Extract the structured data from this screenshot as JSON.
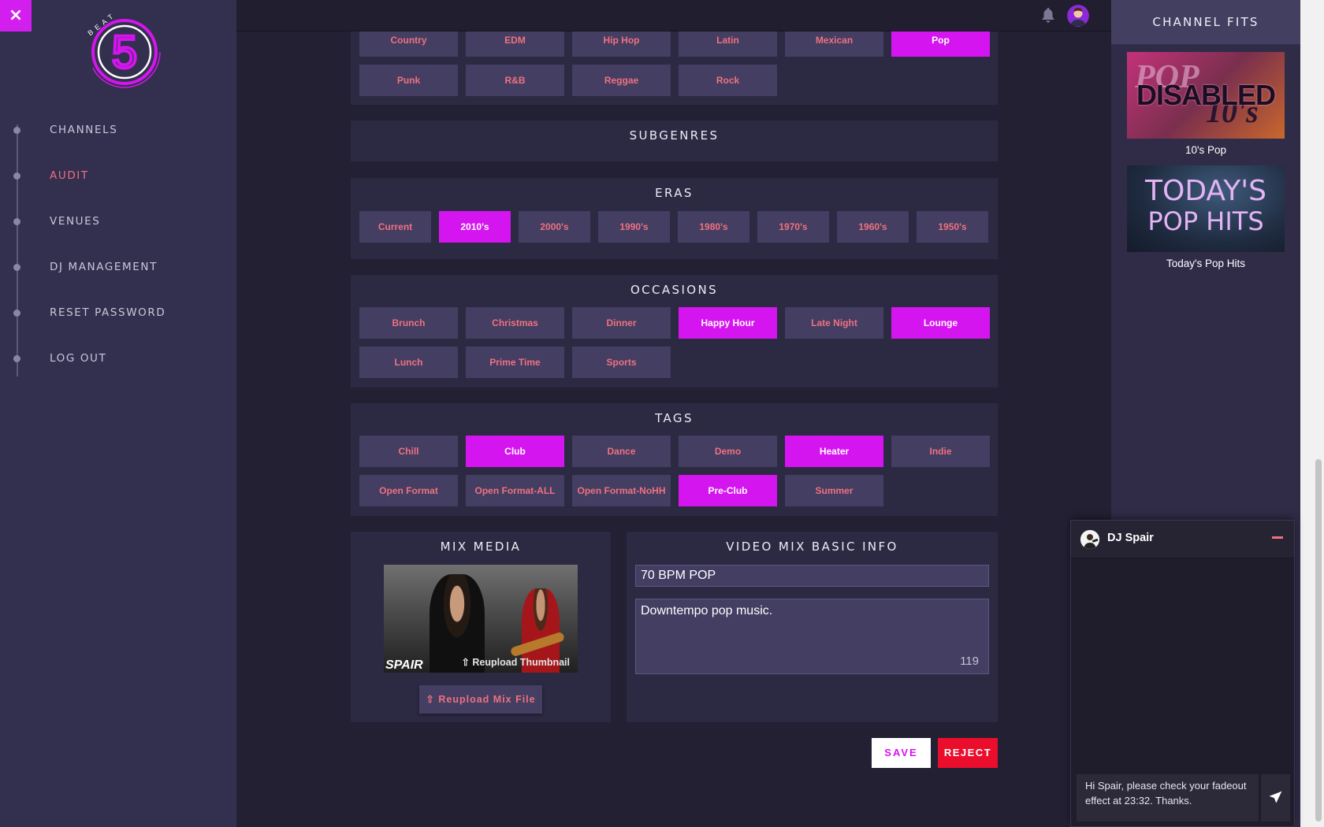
{
  "sidebar": {
    "close_icon": "×",
    "logo_text": "BEAT",
    "logo_number": "5",
    "nav": [
      {
        "label": "CHANNELS",
        "active": false
      },
      {
        "label": "AUDIT",
        "active": true
      },
      {
        "label": "VENUES",
        "active": false
      },
      {
        "label": "DJ MANAGEMENT",
        "active": false
      },
      {
        "label": "RESET PASSWORD",
        "active": false
      },
      {
        "label": "LOG OUT",
        "active": false
      }
    ]
  },
  "colors": {
    "accent": "#d515ef",
    "label": "#f0717f",
    "reject": "#ea0e2c"
  },
  "genres": {
    "items": [
      {
        "label": "Country",
        "selected": false
      },
      {
        "label": "EDM",
        "selected": false
      },
      {
        "label": "Hip Hop",
        "selected": false
      },
      {
        "label": "Latin",
        "selected": false
      },
      {
        "label": "Mexican",
        "selected": false
      },
      {
        "label": "Pop",
        "selected": true
      },
      {
        "label": "Punk",
        "selected": false
      },
      {
        "label": "R&B",
        "selected": false
      },
      {
        "label": "Reggae",
        "selected": false
      },
      {
        "label": "Rock",
        "selected": false
      }
    ]
  },
  "subgenres": {
    "title": "SUBGENRES"
  },
  "eras": {
    "title": "ERAS",
    "items": [
      {
        "label": "Current",
        "selected": false
      },
      {
        "label": "2010's",
        "selected": true
      },
      {
        "label": "2000's",
        "selected": false
      },
      {
        "label": "1990's",
        "selected": false
      },
      {
        "label": "1980's",
        "selected": false
      },
      {
        "label": "1970's",
        "selected": false
      },
      {
        "label": "1960's",
        "selected": false
      },
      {
        "label": "1950's",
        "selected": false
      }
    ]
  },
  "occasions": {
    "title": "OCCASIONS",
    "items": [
      {
        "label": "Brunch",
        "selected": false
      },
      {
        "label": "Christmas",
        "selected": false
      },
      {
        "label": "Dinner",
        "selected": false
      },
      {
        "label": "Happy Hour",
        "selected": true
      },
      {
        "label": "Late Night",
        "selected": false
      },
      {
        "label": "Lounge",
        "selected": true
      },
      {
        "label": "Lunch",
        "selected": false
      },
      {
        "label": "Prime Time",
        "selected": false
      },
      {
        "label": "Sports",
        "selected": false
      }
    ]
  },
  "tags": {
    "title": "TAGS",
    "items": [
      {
        "label": "Chill",
        "selected": false
      },
      {
        "label": "Club",
        "selected": true
      },
      {
        "label": "Dance",
        "selected": false
      },
      {
        "label": "Demo",
        "selected": false
      },
      {
        "label": "Heater",
        "selected": true
      },
      {
        "label": "Indie",
        "selected": false
      },
      {
        "label": "Open Format",
        "selected": false
      },
      {
        "label": "Open Format-ALL",
        "selected": false
      },
      {
        "label": "Open Format-NoHH",
        "selected": false
      },
      {
        "label": "Pre-Club",
        "selected": true
      },
      {
        "label": "Summer",
        "selected": false
      }
    ]
  },
  "mix_media": {
    "title": "MIX MEDIA",
    "thumbnail_watermark": "SPAIR",
    "reupload_thumbnail": "Reupload Thumbnail",
    "reupload_mix": "Reupload Mix File"
  },
  "video_info": {
    "title": "VIDEO MIX BASIC INFO",
    "mix_title": "70 BPM POP",
    "description": "Downtempo pop music.",
    "char_count": "119"
  },
  "actions": {
    "save": "SAVE",
    "reject": "REJECT"
  },
  "channel_fits": {
    "title": "CHANNEL FITS",
    "items": [
      {
        "label": "10's Pop",
        "image_text": "DISABLED",
        "image_bg_text_1": "POP",
        "image_bg_text_2": "10's"
      },
      {
        "label": "Today's Pop Hits",
        "image_text_1": "TODAY'S",
        "image_text_2": "POP HITS"
      }
    ]
  },
  "chat": {
    "name": "DJ Spair",
    "message": "Hi Spair, please check your fadeout effect at 23:32. Thanks."
  },
  "icons": {
    "close": "close-icon",
    "bell": "bell-icon",
    "avatar": "user-avatar",
    "upload": "upload-icon",
    "send": "send-icon",
    "minimize": "minimize-icon"
  }
}
